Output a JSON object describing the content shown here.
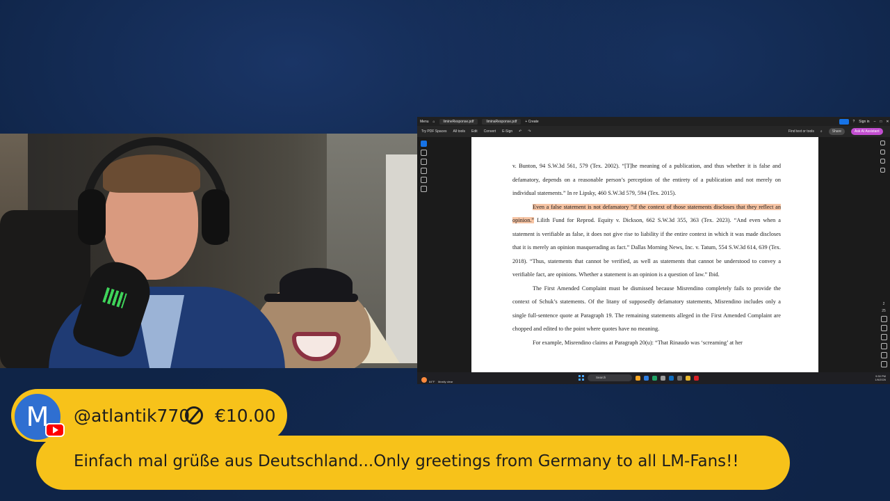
{
  "superchat": {
    "avatar_letter": "M",
    "username": "@atlantik770",
    "amount": "€10.00",
    "message": "Einfach mal grüße aus Deutschland...Only greetings from Germany to all LM-Fans!!",
    "color": "#f7c21a"
  },
  "pdf_app": {
    "titlebar": {
      "menu": "Menu",
      "tab1": "limineResponse.pdf",
      "tab2": "liminaResponse.pdf",
      "create": "+ Create",
      "sign_in": "Sign in"
    },
    "toolbar": {
      "try_spaces": "Try PDF Spaces",
      "all_tools": "All tools",
      "edit": "Edit",
      "convert": "Convert",
      "esign": "E-Sign",
      "find": "Find text or tools",
      "share": "Share",
      "ai_assistant": "Ask AI Assistant"
    },
    "zoom": {
      "page": "2",
      "of": "25"
    },
    "document": {
      "p1": "v. Bunton, 94 S.W.3d 561, 579 (Tex. 2002). “[T]he meaning of a publication, and thus whether it is false and defamatory, depends on a reasonable person’s perception of the entirety of a publication and not merely on individual statements.” In re Lipsky, 460 S.W.3d 579, 594 (Tex. 2015).",
      "p2_highlight": "Even a false statement is not defamatory “if the context of those statements discloses that they reflect an opinion.”",
      "p2_rest": " Lilith Fund for Reprod. Equity v. Dickson, 662 S.W.3d 355, 363 (Tex. 2023). “And even when a statement is verifiable as false, it does not give rise to liability if the entire context in which it was made discloses that it is merely an opinion masquerading as fact.” Dallas Morning News, Inc. v. Tatum, 554 S.W.3d 614, 639 (Tex. 2018). “Thus, statements that cannot be verified, as well as statements that cannot be understood to convey a verifiable fact, are opinions. Whether a statement is an opinion is a question of law.” Ibid.",
      "p3": "The First Amended Complaint must be dismissed because Misrendino completely fails to provide the context of Schuk’s statements. Of the litany of supposedly defamatory statements, Misrendino includes only a single full-sentence quote at Paragraph 19. The remaining statements alleged in the First Amended Complaint are chopped and edited to the point where quotes have no meaning.",
      "p4": "For example, Misrendino claims at Paragraph 20(u): “That Rinaudo was ‘screaming’ at her"
    },
    "taskbar": {
      "weather_temp": "84°F",
      "weather_desc": "Mostly clear",
      "search": "Search",
      "time": "9:30 PM",
      "date": "1/6/2026"
    }
  }
}
